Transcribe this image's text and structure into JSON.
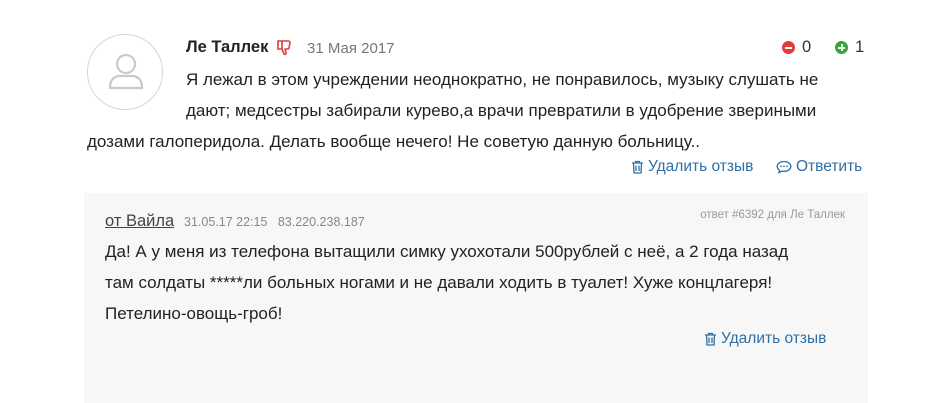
{
  "review": {
    "author": "Ле Таллек",
    "date": "31 Мая 2017",
    "votes": {
      "down": "0",
      "up": "1"
    },
    "text_lines": [
      "Я лежал в этом учреждении неоднократно, не понравилось, музыку слушать не",
      "дают; медсестры забирали курево,а врачи превратили в удобрение звериными",
      "дозами галоперидола. Делать вообще нечего! Не советую данную больницу.."
    ],
    "actions": {
      "delete": "Удалить отзыв",
      "reply": "Ответить"
    }
  },
  "reply": {
    "author": "от Вайла",
    "meta": "31.05.17 22:15   83.220.238.187",
    "reference": "ответ #6392 для Ле Таллек",
    "text_lines": [
      "Да! А у меня из телефона вытащили симку ухохотали 500рублей с неё, а 2 года назад",
      "там солдаты *****ли больных ногами и не давали ходить в туалет! Хуже концлагеря!",
      "Петелино-овощь-гроб!"
    ],
    "delete": "Удалить отзыв"
  },
  "colors": {
    "link": "#2f6fa6",
    "vote_down": "#e03d3d",
    "vote_up": "#3ba53b",
    "dislike": "#e03d3d"
  }
}
